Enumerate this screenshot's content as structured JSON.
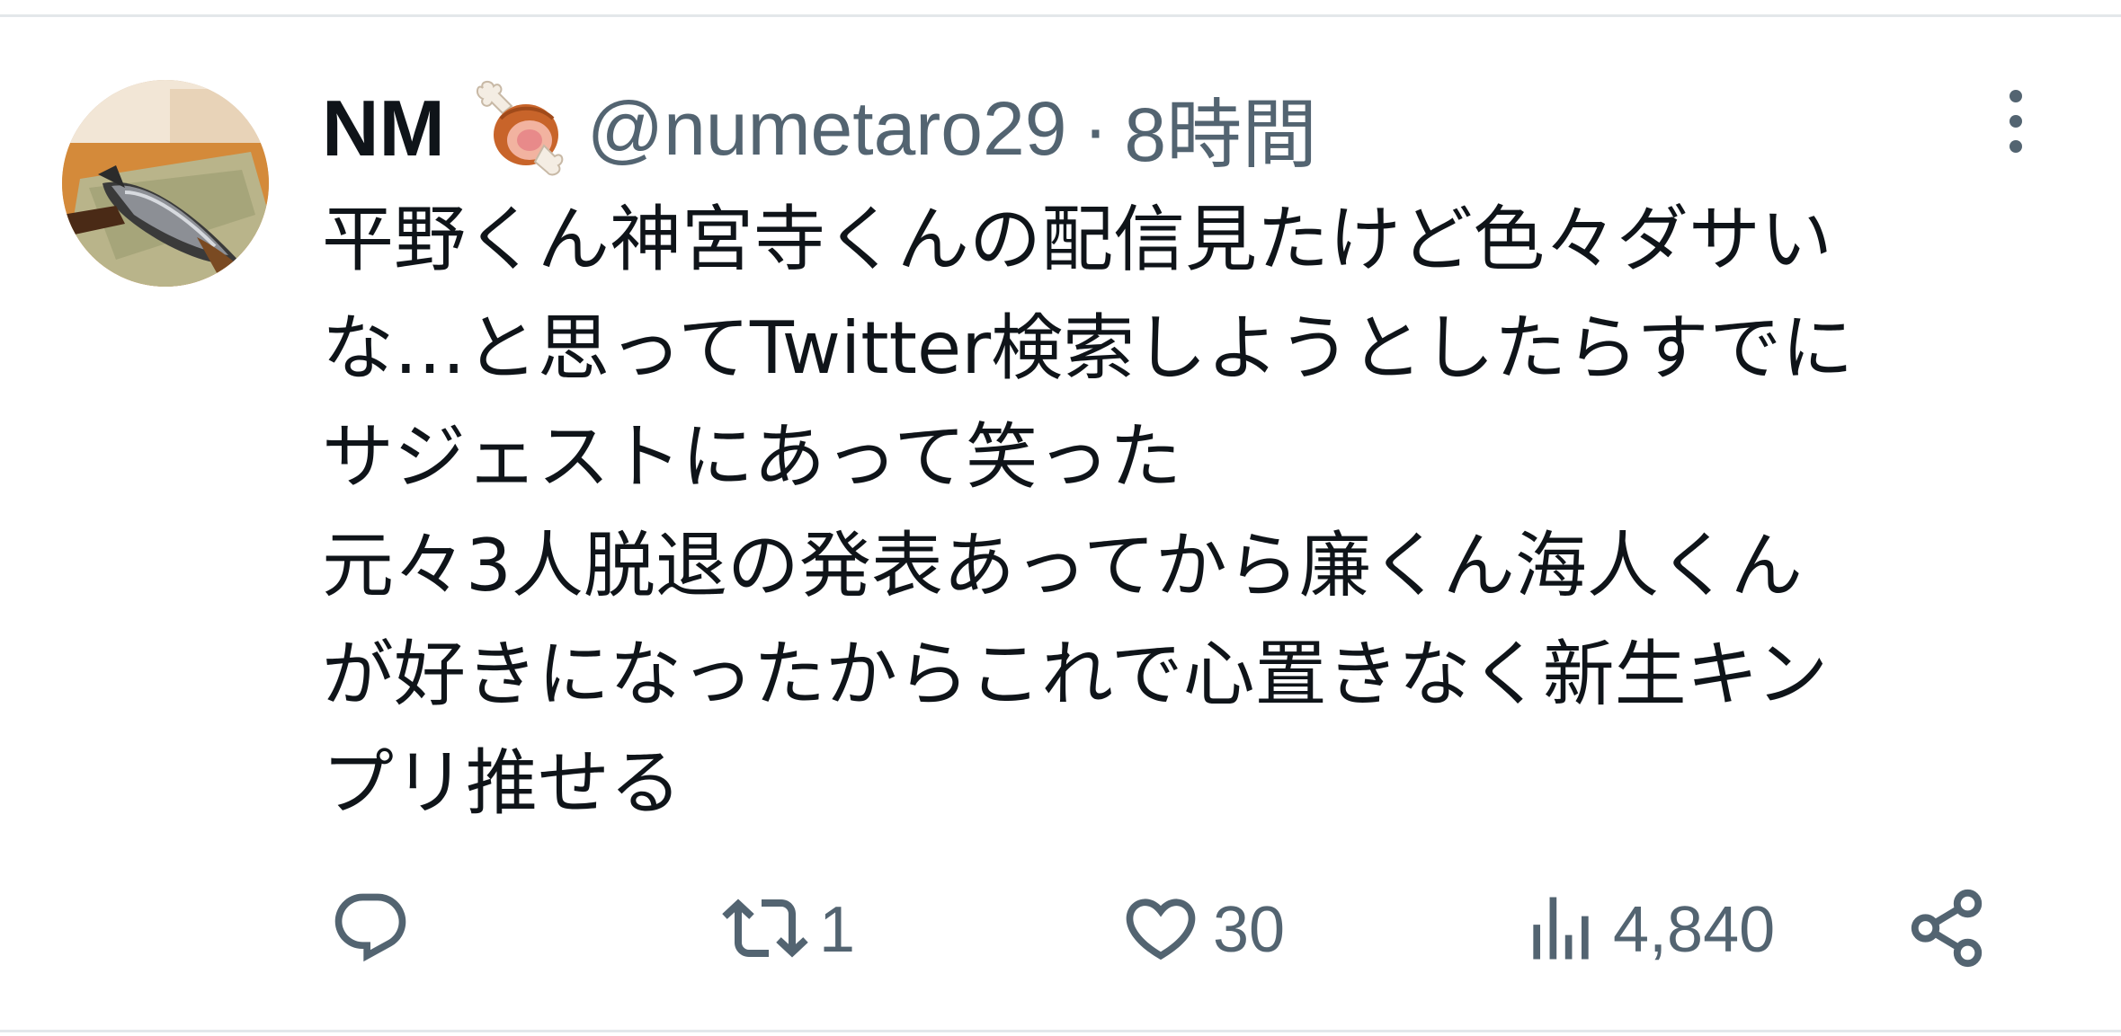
{
  "tweet": {
    "author": {
      "display_name": "NM",
      "name_emoji": "meat-on-bone-emoji",
      "handle": "@numetaro29",
      "avatar": "grilled-fish-avatar"
    },
    "separator": "·",
    "timestamp": "8時間",
    "more_icon": "more-vertical-icon",
    "text_lines": [
      "平野くん神宮寺くんの配信見たけど色々ダサい",
      "な…と思ってTwitter検索しようとしたらすでに",
      "サジェストにあって笑った",
      "元々3人脱退の発表あってから廉くん海人くん",
      "が好きになったからこれで心置きなく新生キン",
      "プリ推せる"
    ],
    "actions": {
      "reply": {
        "icon": "reply-icon",
        "count": ""
      },
      "retweet": {
        "icon": "retweet-icon",
        "count": "1"
      },
      "like": {
        "icon": "heart-icon",
        "count": "30"
      },
      "views": {
        "icon": "views-icon",
        "count": "4,840"
      },
      "share": {
        "icon": "share-icon"
      }
    },
    "colors": {
      "text": "#0f1419",
      "secondary": "#536471",
      "divider": "#e3e7ea"
    }
  }
}
